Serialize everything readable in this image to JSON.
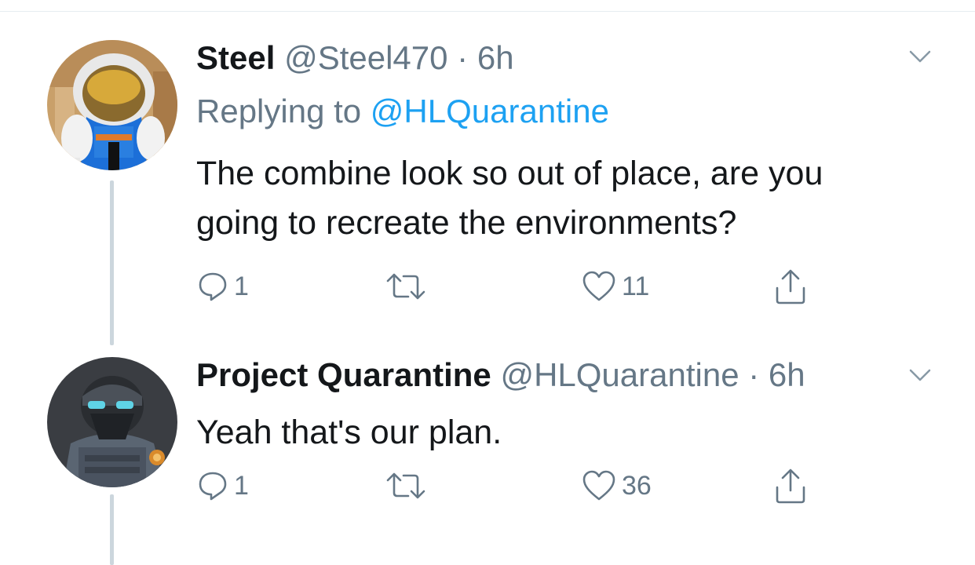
{
  "tweets": [
    {
      "display_name": "Steel",
      "handle": "@Steel470",
      "separator": "·",
      "time": "6h",
      "reply_prefix": "Replying to",
      "reply_handle": "@HLQuarantine",
      "lines": [
        "The combine look so out of place, are you",
        "going to recreate the environments?"
      ],
      "replies": "1",
      "likes": "11",
      "avatar_icon": "astronaut-avatar"
    },
    {
      "display_name": "Project Quarantine",
      "handle": "@HLQuarantine",
      "separator": "·",
      "time": "6h",
      "lines": [
        "Yeah that's our plan."
      ],
      "replies": "1",
      "likes": "36",
      "avatar_icon": "combine-soldier-avatar"
    }
  ],
  "colors": {
    "text": "#14171a",
    "muted": "#657786",
    "link": "#1da1f2",
    "thread_line": "#ccd6dd"
  }
}
